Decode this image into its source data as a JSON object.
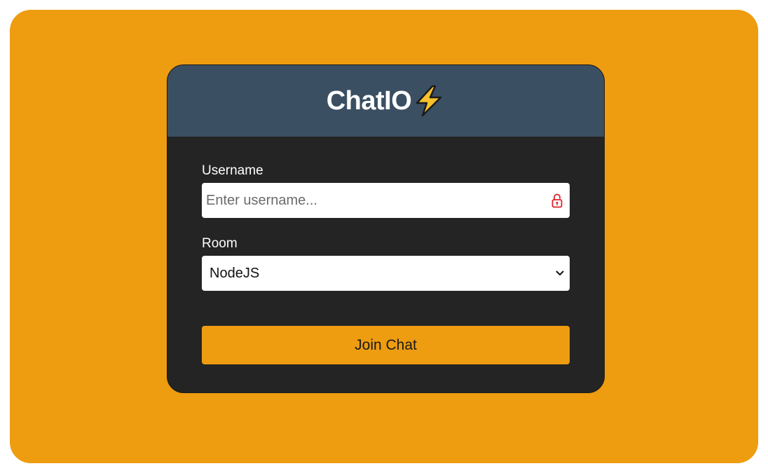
{
  "app": {
    "title": "ChatIO",
    "title_icon": "lightning-bolt-icon"
  },
  "form": {
    "username": {
      "label": "Username",
      "placeholder": "Enter username...",
      "value": "",
      "icon": "lock-icon"
    },
    "room": {
      "label": "Room",
      "selected": "NodeJS",
      "icon": "chevron-down-icon"
    },
    "submit_label": "Join Chat"
  },
  "colors": {
    "background": "#ee9c10",
    "card": "#242424",
    "header": "#3b4f63",
    "button": "#ee9c10",
    "lock_icon": "#e0202a"
  }
}
